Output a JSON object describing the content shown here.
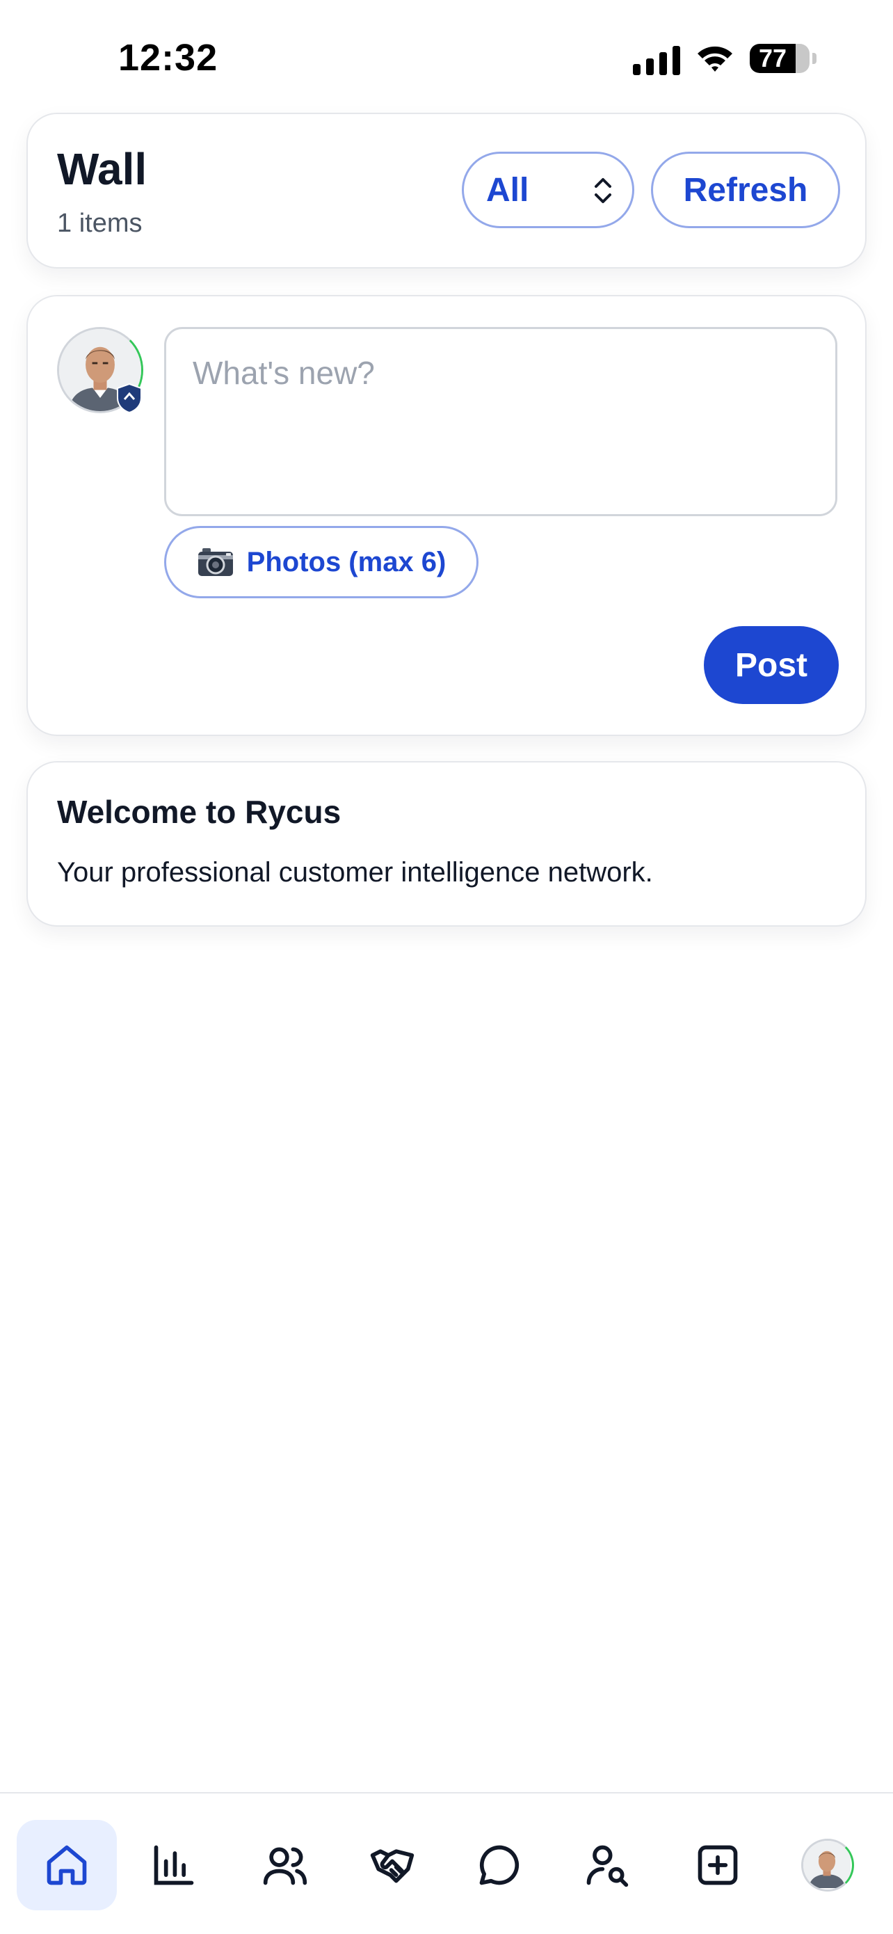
{
  "status_bar": {
    "time": "12:32",
    "battery_level": "77",
    "battery_fraction": 0.77
  },
  "header": {
    "title": "Wall",
    "item_count": "1 items",
    "filter_value": "All",
    "refresh_label": "Refresh"
  },
  "composer": {
    "placeholder": "What's new?",
    "photos_label": "Photos (max 6)",
    "post_label": "Post"
  },
  "feed": [
    {
      "title": "Welcome to Rycus",
      "body": "Your professional customer intelligence network."
    }
  ],
  "nav": {
    "items": [
      "home-icon",
      "bar-chart-icon",
      "users-icon",
      "handshake-icon",
      "chat-bubble-icon",
      "user-search-icon",
      "plus-square-icon",
      "profile-avatar"
    ],
    "active": "home-icon"
  },
  "colors": {
    "accent": "#1d47d1",
    "accent_border": "#93a8ea",
    "active_nav_bg": "#e8efff",
    "online": "#34c759"
  }
}
